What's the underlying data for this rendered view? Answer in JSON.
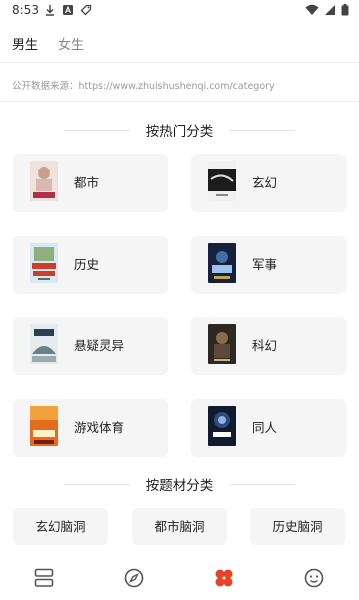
{
  "status_bar": {
    "time": "8:53",
    "left_icons": [
      "download-icon",
      "a-box-icon",
      "tag-icon"
    ],
    "right_icons": [
      "wifi-icon",
      "signal-icon",
      "battery-icon"
    ]
  },
  "gender_tabs": [
    {
      "label": "男生",
      "active": true
    },
    {
      "label": "女生",
      "active": false
    }
  ],
  "source": {
    "text": "公开数据来源：https://www.zhuishushenqi.com/category"
  },
  "hot_section": {
    "title": "按热门分类",
    "categories": [
      {
        "label": "都市",
        "cover_color": "#e9d8d2"
      },
      {
        "label": "玄幻",
        "cover_color": "#1f1f1f"
      },
      {
        "label": "历史",
        "cover_color": "#d6e6ef"
      },
      {
        "label": "军事",
        "cover_color": "#1b2a4a"
      },
      {
        "label": "悬疑灵异",
        "cover_color": "#dfe8ec"
      },
      {
        "label": "科幻",
        "cover_color": "#3a3128"
      },
      {
        "label": "游戏体育",
        "cover_color": "#e0641c"
      },
      {
        "label": "同人",
        "cover_color": "#162238"
      }
    ]
  },
  "theme_section": {
    "title": "按题材分类",
    "chips": [
      "玄幻脑洞",
      "都市脑洞",
      "历史脑洞"
    ]
  },
  "bottom_nav": {
    "items": [
      {
        "icon": "bookshelf-icon",
        "active": false
      },
      {
        "icon": "compass-icon",
        "active": false
      },
      {
        "icon": "category-icon",
        "active": true
      },
      {
        "icon": "smiley-icon",
        "active": false
      }
    ],
    "accent_color": "#e8412c"
  }
}
